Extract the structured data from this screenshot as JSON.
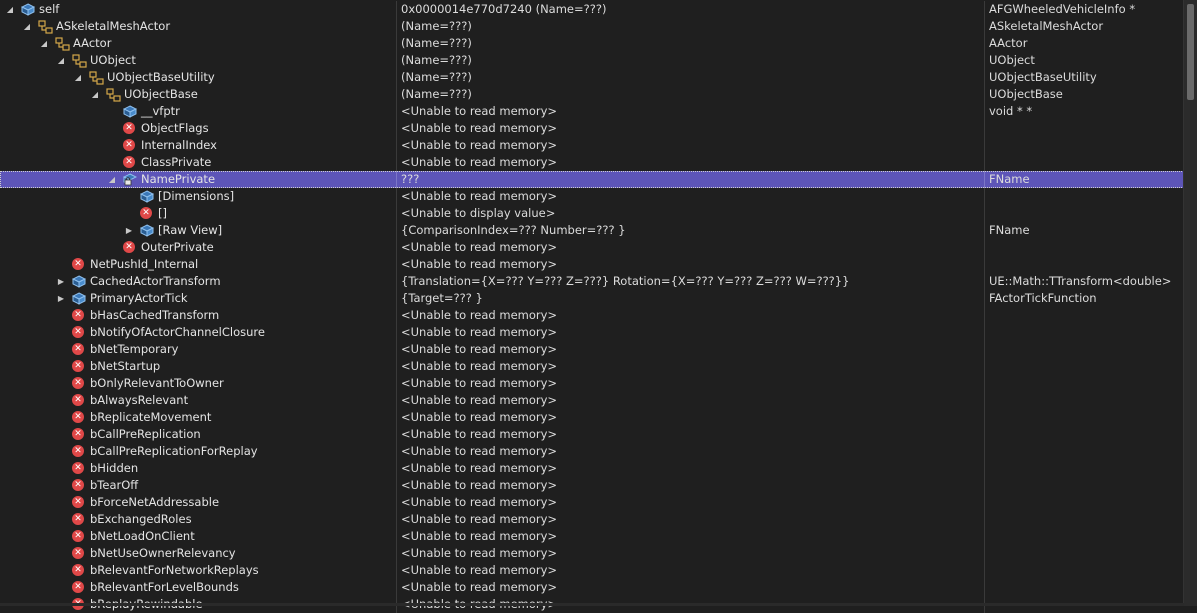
{
  "watch": {
    "rows": [
      {
        "depth": 0,
        "expander": "expanded",
        "icon": "object-icon",
        "name": "self",
        "value": "0x0000014e770d7240 (Name=???)",
        "type": "AFGWheeledVehicleInfo *"
      },
      {
        "depth": 1,
        "expander": "expanded",
        "icon": "base-class-icon",
        "name": "ASkeletalMeshActor",
        "value": "(Name=???)",
        "type": "ASkeletalMeshActor"
      },
      {
        "depth": 2,
        "expander": "expanded",
        "icon": "base-class-icon",
        "name": "AActor",
        "value": "(Name=???)",
        "type": "AActor"
      },
      {
        "depth": 3,
        "expander": "expanded",
        "icon": "base-class-icon",
        "name": "UObject",
        "value": "(Name=???)",
        "type": "UObject"
      },
      {
        "depth": 4,
        "expander": "expanded",
        "icon": "base-class-icon",
        "name": "UObjectBaseUtility",
        "value": "(Name=???)",
        "type": "UObjectBaseUtility"
      },
      {
        "depth": 5,
        "expander": "expanded",
        "icon": "base-class-icon",
        "name": "UObjectBase",
        "value": "(Name=???)",
        "type": "UObjectBase"
      },
      {
        "depth": 6,
        "expander": "none",
        "icon": "object-icon",
        "name": "__vfptr",
        "value": "<Unable to read memory>",
        "type": "void * *"
      },
      {
        "depth": 6,
        "expander": "none",
        "icon": "error-icon",
        "name": "ObjectFlags",
        "value": "<Unable to read memory>",
        "type": ""
      },
      {
        "depth": 6,
        "expander": "none",
        "icon": "error-icon",
        "name": "InternalIndex",
        "value": "<Unable to read memory>",
        "type": ""
      },
      {
        "depth": 6,
        "expander": "none",
        "icon": "error-icon",
        "name": "ClassPrivate",
        "value": "<Unable to read memory>",
        "type": ""
      },
      {
        "depth": 6,
        "expander": "expanded",
        "icon": "lock-icon",
        "name": "NamePrivate",
        "value": "???",
        "type": "FName",
        "selected": true
      },
      {
        "depth": 7,
        "expander": "none",
        "icon": "object-icon",
        "name": "[Dimensions]",
        "value": "<Unable to read memory>",
        "type": ""
      },
      {
        "depth": 7,
        "expander": "none",
        "icon": "error-icon",
        "name": "[]",
        "value": "<Unable to display value>",
        "type": ""
      },
      {
        "depth": 7,
        "expander": "collapsed",
        "icon": "object-icon",
        "name": "[Raw View]",
        "value": "{ComparisonIndex=??? Number=??? }",
        "type": "FName"
      },
      {
        "depth": 6,
        "expander": "none",
        "icon": "error-icon",
        "name": "OuterPrivate",
        "value": "<Unable to read memory>",
        "type": ""
      },
      {
        "depth": 3,
        "expander": "none",
        "icon": "error-icon",
        "name": "NetPushId_Internal",
        "value": "<Unable to read memory>",
        "type": ""
      },
      {
        "depth": 3,
        "expander": "collapsed",
        "icon": "object-icon",
        "name": "CachedActorTransform",
        "value": "{Translation={X=??? Y=??? Z=???} Rotation={X=??? Y=??? Z=??? W=???}}",
        "type": "UE::Math::TTransform<double>"
      },
      {
        "depth": 3,
        "expander": "collapsed",
        "icon": "object-icon",
        "name": "PrimaryActorTick",
        "value": "{Target=??? }",
        "type": "FActorTickFunction"
      },
      {
        "depth": 3,
        "expander": "none",
        "icon": "error-icon",
        "name": "bHasCachedTransform",
        "value": "<Unable to read memory>",
        "type": ""
      },
      {
        "depth": 3,
        "expander": "none",
        "icon": "error-icon",
        "name": "bNotifyOfActorChannelClosure",
        "value": "<Unable to read memory>",
        "type": ""
      },
      {
        "depth": 3,
        "expander": "none",
        "icon": "error-icon",
        "name": "bNetTemporary",
        "value": "<Unable to read memory>",
        "type": ""
      },
      {
        "depth": 3,
        "expander": "none",
        "icon": "error-icon",
        "name": "bNetStartup",
        "value": "<Unable to read memory>",
        "type": ""
      },
      {
        "depth": 3,
        "expander": "none",
        "icon": "error-icon",
        "name": "bOnlyRelevantToOwner",
        "value": "<Unable to read memory>",
        "type": ""
      },
      {
        "depth": 3,
        "expander": "none",
        "icon": "error-icon",
        "name": "bAlwaysRelevant",
        "value": "<Unable to read memory>",
        "type": ""
      },
      {
        "depth": 3,
        "expander": "none",
        "icon": "error-icon",
        "name": "bReplicateMovement",
        "value": "<Unable to read memory>",
        "type": ""
      },
      {
        "depth": 3,
        "expander": "none",
        "icon": "error-icon",
        "name": "bCallPreReplication",
        "value": "<Unable to read memory>",
        "type": ""
      },
      {
        "depth": 3,
        "expander": "none",
        "icon": "error-icon",
        "name": "bCallPreReplicationForReplay",
        "value": "<Unable to read memory>",
        "type": ""
      },
      {
        "depth": 3,
        "expander": "none",
        "icon": "error-icon",
        "name": "bHidden",
        "value": "<Unable to read memory>",
        "type": ""
      },
      {
        "depth": 3,
        "expander": "none",
        "icon": "error-icon",
        "name": "bTearOff",
        "value": "<Unable to read memory>",
        "type": ""
      },
      {
        "depth": 3,
        "expander": "none",
        "icon": "error-icon",
        "name": "bForceNetAddressable",
        "value": "<Unable to read memory>",
        "type": ""
      },
      {
        "depth": 3,
        "expander": "none",
        "icon": "error-icon",
        "name": "bExchangedRoles",
        "value": "<Unable to read memory>",
        "type": ""
      },
      {
        "depth": 3,
        "expander": "none",
        "icon": "error-icon",
        "name": "bNetLoadOnClient",
        "value": "<Unable to read memory>",
        "type": ""
      },
      {
        "depth": 3,
        "expander": "none",
        "icon": "error-icon",
        "name": "bNetUseOwnerRelevancy",
        "value": "<Unable to read memory>",
        "type": ""
      },
      {
        "depth": 3,
        "expander": "none",
        "icon": "error-icon",
        "name": "bRelevantForNetworkReplays",
        "value": "<Unable to read memory>",
        "type": ""
      },
      {
        "depth": 3,
        "expander": "none",
        "icon": "error-icon",
        "name": "bRelevantForLevelBounds",
        "value": "<Unable to read memory>",
        "type": ""
      },
      {
        "depth": 3,
        "expander": "none",
        "icon": "error-icon",
        "name": "bReplayRewindable",
        "value": "<Unable to read memory>",
        "type": ""
      }
    ]
  },
  "colors": {
    "background": "#1f1f1f",
    "selected_row": "#5d55b8",
    "error_icon": "#e04848",
    "object_icon": "#6fa8dc",
    "base_class_icon": "#d4a84a"
  }
}
